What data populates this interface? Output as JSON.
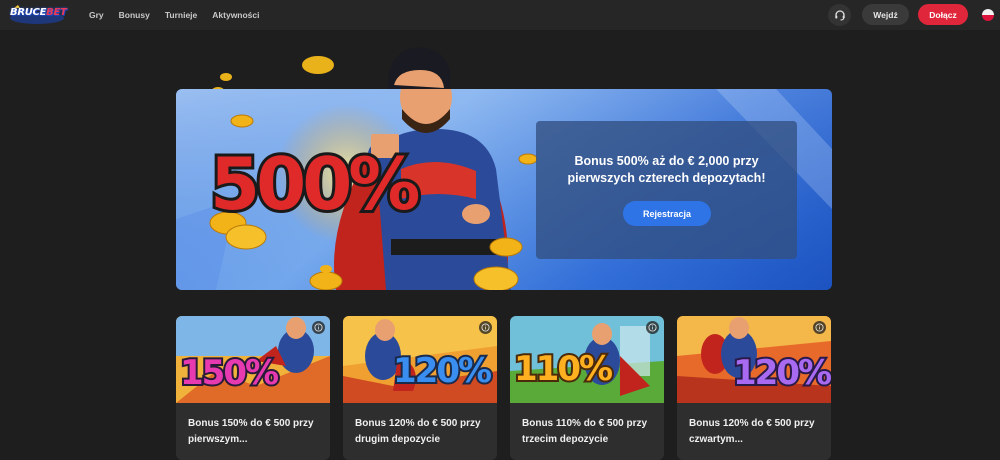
{
  "brand": {
    "logo_text_main": "BRUCE",
    "logo_text_accent": "BET"
  },
  "nav": {
    "items": [
      {
        "label": "Gry"
      },
      {
        "label": "Bonusy"
      },
      {
        "label": "Turnieje"
      },
      {
        "label": "Aktywności"
      }
    ]
  },
  "header": {
    "support_icon": "headset-icon",
    "login_label": "Wejdź",
    "join_label": "Dołącz",
    "language_flag": "flag-pl-icon"
  },
  "colors": {
    "join_button": "#e0263a",
    "register_button": "#2f74e6",
    "background": "#1e1e1e",
    "topbar": "#262626",
    "card": "#2e2e2e"
  },
  "hero": {
    "badge_text": "500%",
    "title": "Bonus 500% aż do € 2,000 przy pierwszych czterech depozytach!",
    "register_label": "Rejestracja"
  },
  "cards": [
    {
      "badge": "150%",
      "title": "Bonus 150% do € 500 przy pierwszym..."
    },
    {
      "badge": "120%",
      "title": "Bonus 120% do € 500 przy drugim depozycie"
    },
    {
      "badge": "110%",
      "title": "Bonus 110% do € 500 przy trzecim depozycie"
    },
    {
      "badge": "120%",
      "title": "Bonus 120% do € 500 przy czwartym..."
    }
  ]
}
